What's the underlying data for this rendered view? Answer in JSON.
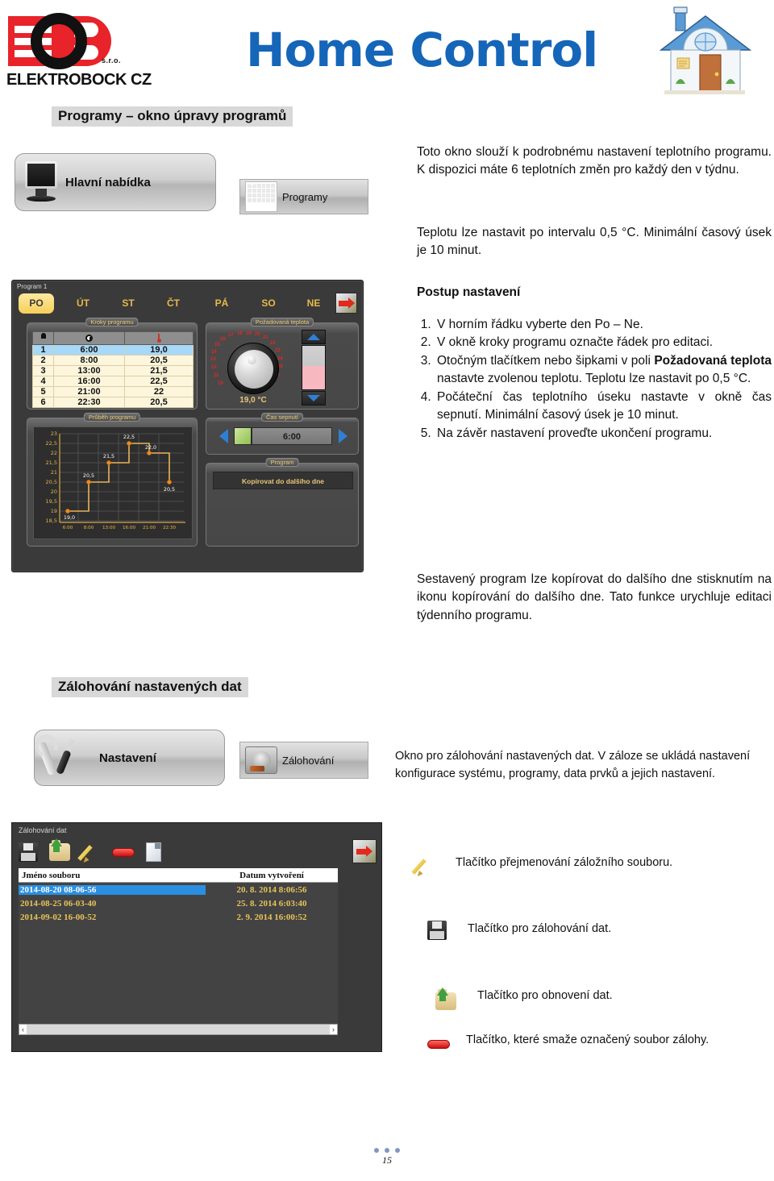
{
  "header": {
    "brand_name": "ELEKTROBOCK CZ",
    "brand_suffix": "s.r.o.",
    "app_title": "Home Control",
    "title_color": "#1565b8",
    "house_icon": "house-icon"
  },
  "sections": {
    "programs_title": "Programy – okno úpravy programů",
    "backup_title": "Zálohování nastavených dat"
  },
  "menu_buttons": {
    "main_menu": "Hlavní nabídka",
    "programy": "Programy",
    "nastaveni": "Nastavení",
    "zalohovani": "Zálohování"
  },
  "body_text": {
    "para1": "Toto okno slouží k podrobnému nastavení teplotního programu. K dispozici máte 6 teplotních změn pro každý den v týdnu.",
    "para2": "Teplotu lze nastavit po intervalu 0,5 °C. Minimální časový úsek je 10 minut.",
    "postup_heading": "Postup nastavení",
    "steps": [
      {
        "text_before": "V horním řádku vyberte den Po – Ne.",
        "bold": "",
        "text_after": ""
      },
      {
        "text_before": "V okně kroky programu označte řádek pro editaci.",
        "bold": "",
        "text_after": ""
      },
      {
        "text_before": "Otočným tlačítkem nebo šipkami v poli ",
        "bold": "Požadovaná teplota",
        "text_after": " nastavte zvolenou teplotu. Teplotu lze nastavit po 0,5 °C."
      },
      {
        "text_before": "Počáteční čas teplotního úseku nastavte v okně čas sepnutí. Minimální časový úsek je 10 minut.",
        "bold": "",
        "text_after": ""
      },
      {
        "text_before": "Na závěr nastavení proveďte ukončení programu.",
        "bold": "",
        "text_after": ""
      }
    ],
    "para3": "Sestavený program lze kopírovat do dalšího dne stisknutím na ikonu kopírování do dalšího dne. Tato funkce urychluje editaci týdenního programu.",
    "backup_para": "Okno pro zálohování nastavených dat. V záloze se ukládá nastavení konfigurace systému, programy, data prvků a jejich nastavení."
  },
  "icon_legend": [
    {
      "icon": "pencil-icon",
      "text": "Tlačítko přejmenování záložního souboru."
    },
    {
      "icon": "floppy-icon",
      "text": "Tlačítko pro zálohování dat."
    },
    {
      "icon": "folder-up-icon",
      "text": "Tlačítko pro obnovení dat."
    },
    {
      "icon": "red-minus-icon",
      "text": "Tlačítko, které smaže označený soubor zálohy."
    }
  ],
  "program_window": {
    "window_title": "Program 1",
    "days": [
      "PO",
      "ÚT",
      "ST",
      "ČT",
      "PÁ",
      "SO",
      "NE"
    ],
    "active_day": "PO",
    "exit_icon": "exit-door-icon",
    "panels": {
      "steps": "Kroky programu",
      "temperature": "Požadovaná teplota",
      "graph": "Průběh programu",
      "switch_time": "Čas sepnutí",
      "program": "Program"
    },
    "steps_table": {
      "headers": [
        "hand-icon",
        "clock-icon",
        "thermometer-icon"
      ],
      "rows": [
        {
          "n": "1",
          "time": "6:00",
          "temp": "19,0",
          "selected": true
        },
        {
          "n": "2",
          "time": "8:00",
          "temp": "20,5",
          "selected": false
        },
        {
          "n": "3",
          "time": "13:00",
          "temp": "21,5",
          "selected": false
        },
        {
          "n": "4",
          "time": "16:00",
          "temp": "22,5",
          "selected": false
        },
        {
          "n": "5",
          "time": "21:00",
          "temp": "22",
          "selected": false
        },
        {
          "n": "6",
          "time": "22:30",
          "temp": "20,5",
          "selected": false
        }
      ]
    },
    "dial": {
      "value": "19,0 °C",
      "scale": [
        "10",
        "11",
        "12",
        "13",
        "14",
        "15",
        "16",
        "17",
        "18",
        "19",
        "20",
        "21",
        "22",
        "23",
        "24",
        "25",
        "26",
        "27",
        "28"
      ],
      "up_icon": "chevron-up-icon",
      "down_icon": "chevron-down-icon"
    },
    "switch_time": {
      "value": "6:00",
      "prev_icon": "chevron-left-icon",
      "next_icon": "chevron-right-icon"
    },
    "program_action": "Kopírovat do dalšího dne"
  },
  "chart_data": {
    "type": "line",
    "title": "Průběh programu",
    "xlabel": "",
    "ylabel": "",
    "x": [
      "6:00",
      "8:00",
      "13:00",
      "16:00",
      "21:00",
      "22:30"
    ],
    "values": [
      19.0,
      20.5,
      21.5,
      22.5,
      22.0,
      20.5
    ],
    "point_labels": [
      "19,0",
      "20,5",
      "21,5",
      "22,5",
      "22,0",
      "20,5"
    ],
    "ytick_labels": [
      "23",
      "22,5",
      "22",
      "21,5",
      "21",
      "20,5",
      "20",
      "19,5",
      "19",
      "18,5"
    ],
    "yticks": [
      23,
      22.5,
      22,
      21.5,
      21,
      20.5,
      20,
      19.5,
      19,
      18.5
    ],
    "ylim": [
      18.5,
      23
    ],
    "xtick_labels": [
      "6:00",
      "8:00",
      "13:00",
      "16:00",
      "21:00",
      "22:30"
    ],
    "grid": true,
    "legend": "none",
    "line_color": "#e8a33d",
    "marker_color": "#f08a1c",
    "step_style": "post"
  },
  "backup_window": {
    "window_title": "Zálohování dat",
    "toolbar": [
      "floppy-icon",
      "folder-up-icon",
      "pencil-icon",
      "red-minus-icon",
      "page-icon"
    ],
    "exit_icon": "exit-door-icon",
    "columns": [
      "Jméno souboru",
      "Datum vytvoření"
    ],
    "rows": [
      {
        "name": "2014-08-20 08-06-56",
        "date": "20. 8. 2014 8:06:56",
        "selected": true
      },
      {
        "name": "2014-08-25 06-03-40",
        "date": "25. 8. 2014 6:03:40",
        "selected": false
      },
      {
        "name": "2014-09-02 16-00-52",
        "date": "2. 9. 2014 16:00:52",
        "selected": false
      }
    ],
    "scroll_left": "‹",
    "scroll_right": "›"
  },
  "footer": {
    "page_number": "15"
  }
}
